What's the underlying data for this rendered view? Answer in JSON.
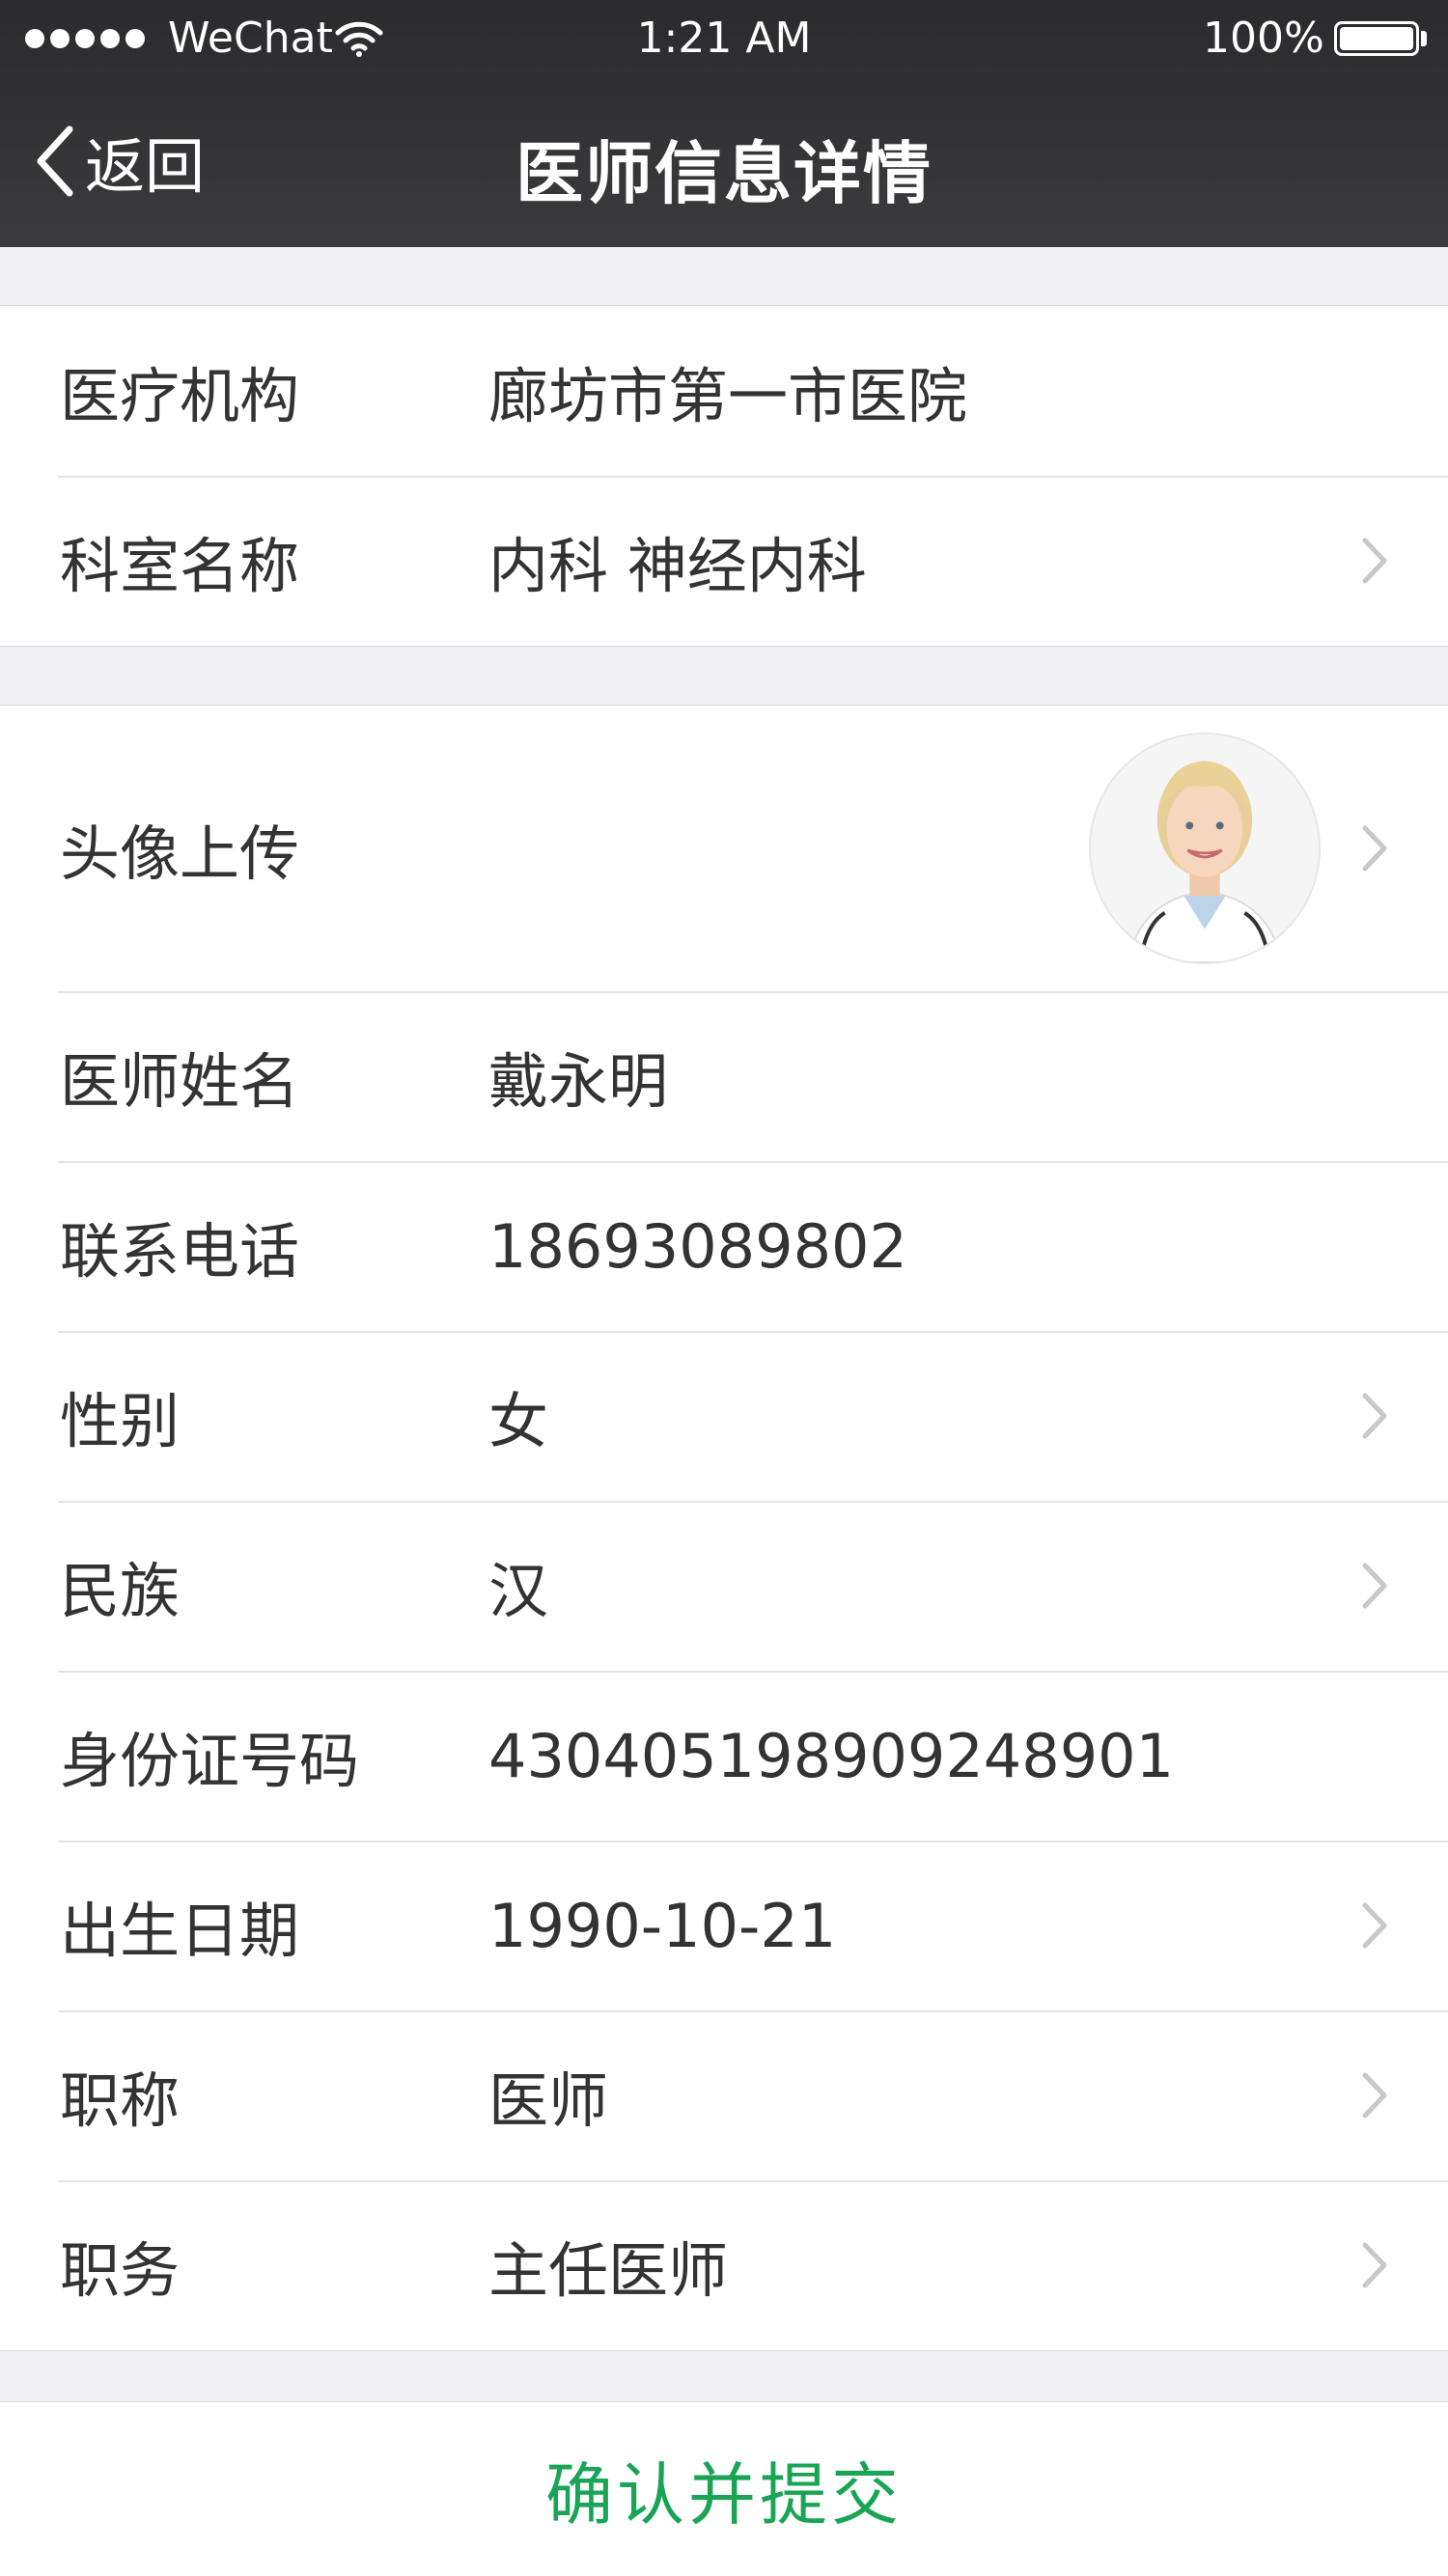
{
  "status_bar": {
    "carrier": "WeChat",
    "time": "1:21 AM",
    "battery": "100%",
    "signal_bars": 5,
    "battery_level": 1.0
  },
  "nav": {
    "back_label": "返回",
    "title": "医师信息详情"
  },
  "section1": {
    "rows": [
      {
        "label": "医疗机构",
        "value": "廊坊市第一市医院"
      },
      {
        "label": "科室名称",
        "value": "内科 神经内科"
      }
    ]
  },
  "section2": {
    "avatar_label": "头像上传",
    "rows": [
      {
        "label": "医师姓名",
        "value": "戴永明"
      },
      {
        "label": "联系电话",
        "value": "18693089802"
      },
      {
        "label": "性别",
        "value": "女"
      },
      {
        "label": "民族",
        "value": "汉"
      },
      {
        "label": "身份证号码",
        "value": "430405198909248901"
      },
      {
        "label": "出生日期",
        "value": "1990-10-21"
      },
      {
        "label": "职称",
        "value": "医师"
      },
      {
        "label": "职务",
        "value": "主任医师"
      }
    ]
  },
  "submit_label": "确认并提交",
  "colors": {
    "nav_bg": "#2b2b2d",
    "page_bg": "#efeff4",
    "accent_green": "#19a555",
    "chevron": "#c7c7cc"
  },
  "icons": [
    "signal-dots",
    "wifi-icon",
    "battery-icon",
    "back-chevron-icon",
    "chevron-right-icon",
    "avatar-photo"
  ]
}
